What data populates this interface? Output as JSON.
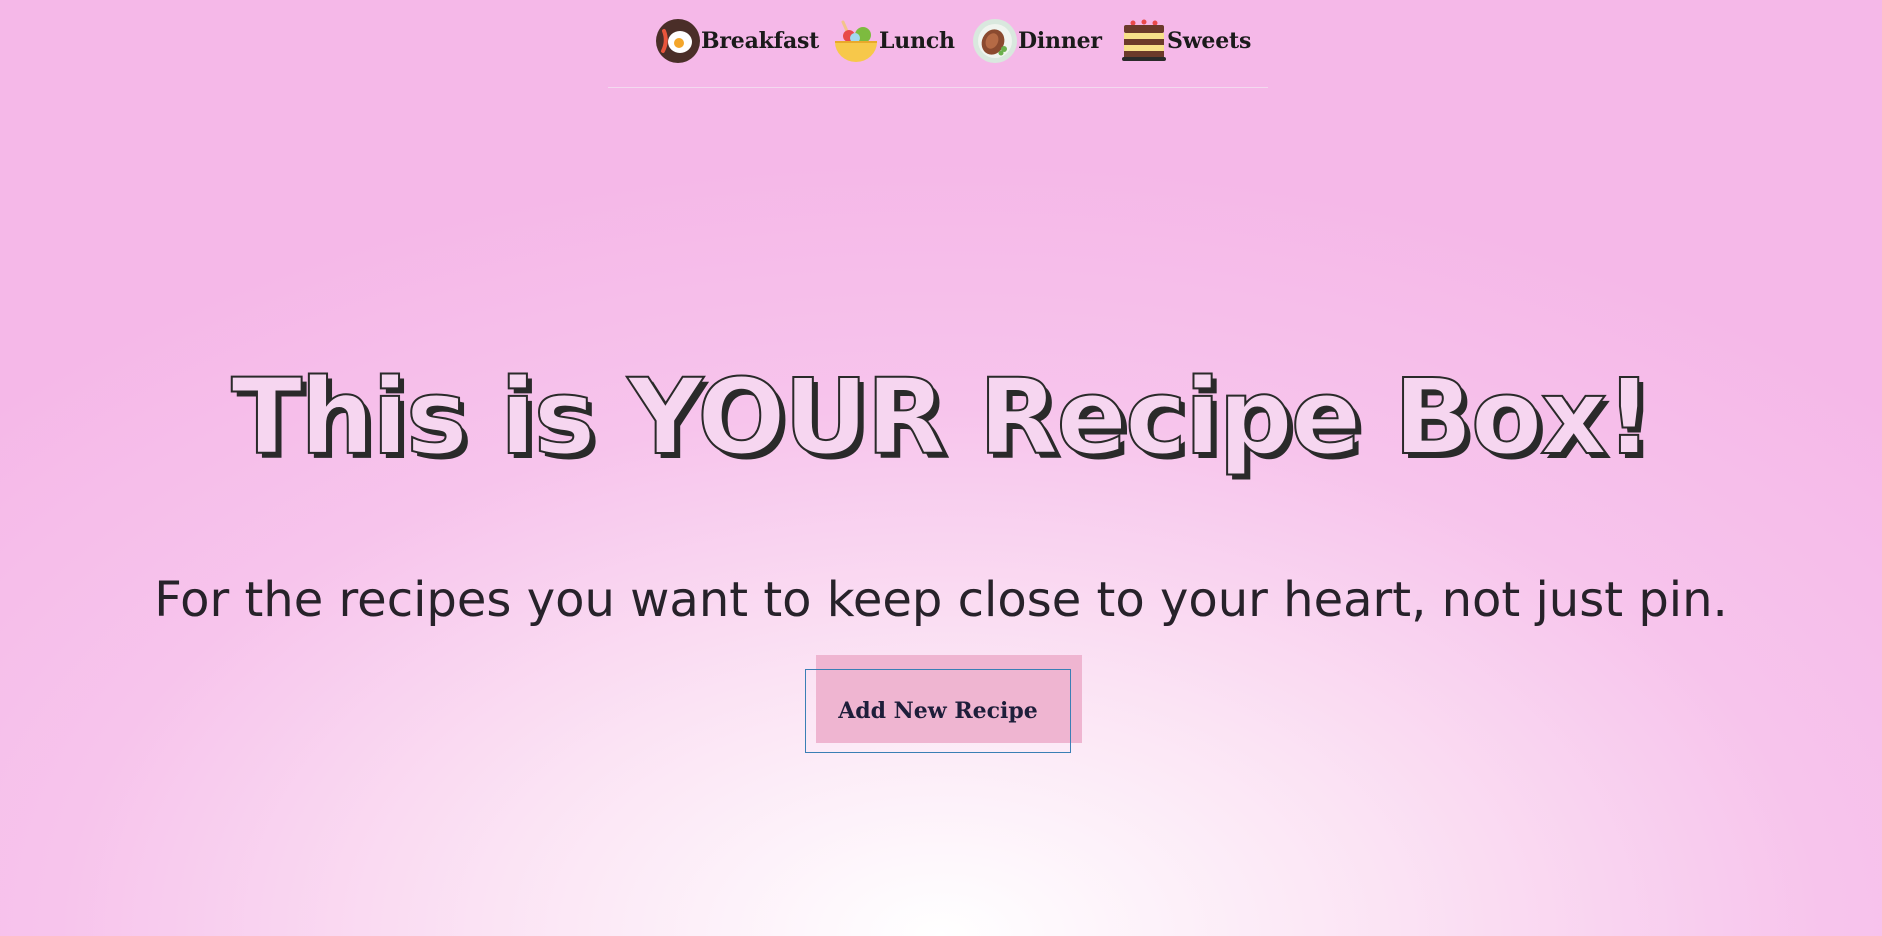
{
  "nav": {
    "items": [
      {
        "label": "Breakfast",
        "icon": "breakfast-plate-icon"
      },
      {
        "label": "Lunch",
        "icon": "salad-bowl-icon"
      },
      {
        "label": "Dinner",
        "icon": "steak-plate-icon"
      },
      {
        "label": "Sweets",
        "icon": "layer-cake-icon"
      }
    ]
  },
  "hero": {
    "title": "This is YOUR Recipe Box!",
    "subtitle": "For the recipes you want to keep close to your heart, not just pin."
  },
  "cta": {
    "label": "Add New Recipe"
  },
  "colors": {
    "background_edge": "#f5b8e8",
    "background_center": "#ffffff",
    "button_shadow": "#efb5d1",
    "button_border": "#3a7fb5",
    "text_dark": "#222222"
  }
}
